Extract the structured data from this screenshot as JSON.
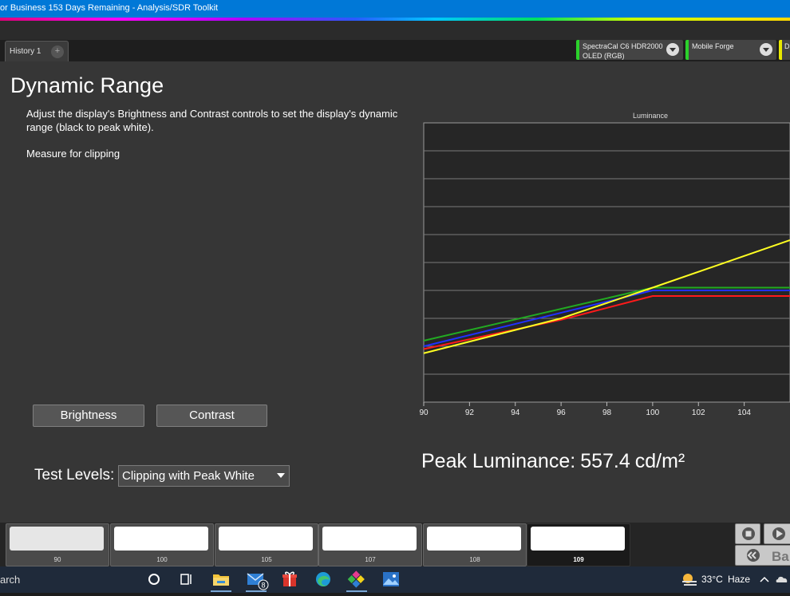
{
  "window": {
    "title": "or Business 153 Days Remaining  - Analysis/SDR Toolkit"
  },
  "tabs": [
    {
      "label": "History 1"
    }
  ],
  "tab_add_label": "+",
  "devices": [
    {
      "line1": "SpectraCal C6 HDR2000",
      "line2": "OLED (RGB)",
      "color": "#2bd12b"
    },
    {
      "line1": "Mobile Forge",
      "line2": "",
      "color": "#2bd12b"
    },
    {
      "line1": "D",
      "line2": "",
      "color": "#e8e800"
    }
  ],
  "page": {
    "title": "Dynamic Range",
    "instructions": "Adjust the display's Brightness and Contrast controls to set the display's dynamic range (black to peak white).",
    "measure_note": "Measure for clipping"
  },
  "buttons": {
    "brightness": "Brightness",
    "contrast": "Contrast"
  },
  "test_levels": {
    "label": "Test Levels:",
    "selected": "Clipping with Peak White"
  },
  "peak": {
    "label": "Peak Luminance:",
    "value": "557.4",
    "unit": "cd/m²"
  },
  "chart_data": {
    "type": "line",
    "title": "Luminance",
    "xlabel": "",
    "ylabel": "",
    "x_ticks": [
      90,
      92,
      94,
      96,
      98,
      100,
      102,
      104
    ],
    "x_tick_labels": [
      "90",
      "92",
      "94",
      "96",
      "98",
      "100",
      "102",
      "104"
    ],
    "xlim": [
      90,
      106
    ],
    "ylim": [
      0,
      10
    ],
    "grid": true,
    "series": [
      {
        "color": "#22aa22",
        "x": [
          90,
          100,
          106
        ],
        "y": [
          2.2,
          4.1,
          4.1
        ]
      },
      {
        "color": "#2030ff",
        "x": [
          90,
          100,
          106
        ],
        "y": [
          2.0,
          4.0,
          4.0
        ]
      },
      {
        "color": "#ff1a1a",
        "x": [
          90,
          96,
          100,
          106
        ],
        "y": [
          1.9,
          2.95,
          3.8,
          3.8
        ]
      },
      {
        "color": "#ffff22",
        "x": [
          90,
          96,
          100,
          106
        ],
        "y": [
          1.75,
          3.0,
          4.1,
          5.8
        ]
      }
    ]
  },
  "swatches": [
    {
      "label": "90",
      "fill": "#e6e6e6"
    },
    {
      "label": "100",
      "fill": "#ffffff"
    },
    {
      "label": "105",
      "fill": "#ffffff"
    },
    {
      "label": "107",
      "fill": "#ffffff"
    },
    {
      "label": "108",
      "fill": "#ffffff"
    },
    {
      "label": "109",
      "fill": "#ffffff"
    }
  ],
  "nav": {
    "back_label": "Ba"
  },
  "taskbar": {
    "search_text": "arch",
    "mail_badge": "8",
    "weather_temp": "33°C",
    "weather_condition": "Haze"
  }
}
